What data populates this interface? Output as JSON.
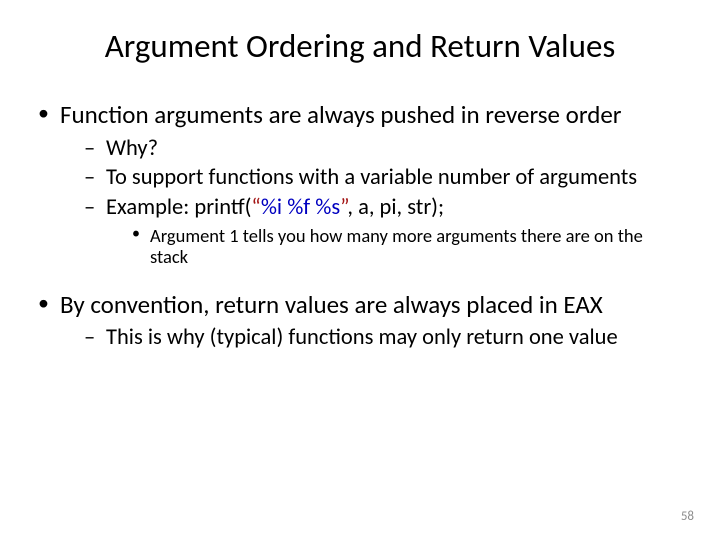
{
  "title": "Argument Ordering and Return Values",
  "b1": {
    "text": "Function arguments are always pushed in reverse order",
    "s1": "Why?",
    "s2": "To support functions with a variable number of arguments",
    "s3_prefix": "Example: ",
    "s3_fn": "printf",
    "s3_open": "(",
    "s3_q1": "“",
    "s3_p1": "%i",
    "s3_sp1": " ",
    "s3_p2": "%f",
    "s3_sp2": " ",
    "s3_p3": "%s",
    "s3_q2": "”",
    "s3_rest": ", a, pi, str);",
    "s3a": "Argument 1 tells you how many more arguments there are on the stack"
  },
  "b2": {
    "text": "By convention, return values are always placed in EAX",
    "s1": "This is why (typical) functions may only return one value"
  },
  "page_number": "58"
}
